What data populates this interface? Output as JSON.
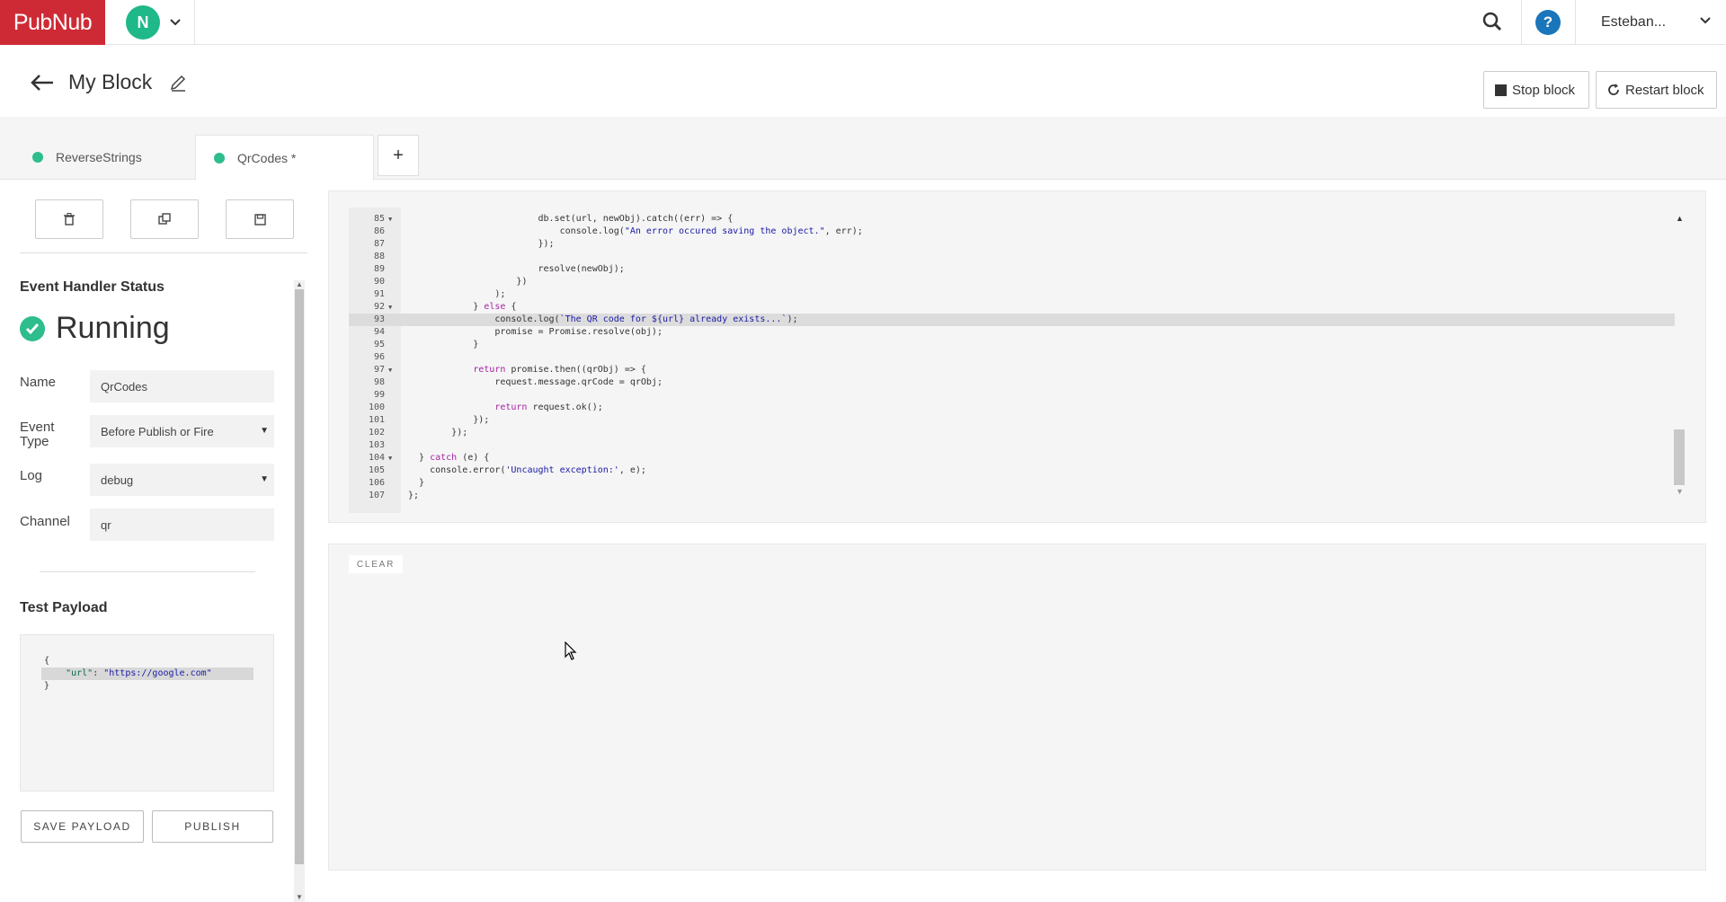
{
  "topbar": {
    "logo": "PubNub",
    "account_initial": "N",
    "user_name": "Esteban...",
    "help_glyph": "?"
  },
  "header": {
    "title": "My Block",
    "stop_label": "Stop block",
    "restart_label": "Restart block"
  },
  "tabs": [
    {
      "label": "ReverseStrings",
      "active": false,
      "status_color": "#2ebd8c"
    },
    {
      "label": "QrCodes *",
      "active": true,
      "status_color": "#2ebd8c"
    }
  ],
  "tab_add_label": "+",
  "left_panel": {
    "status_heading": "Event Handler Status",
    "status_text": "Running",
    "fields": {
      "name_label": "Name",
      "name_value": "QrCodes",
      "event_type_label": "Event Type",
      "event_type_value": "Before Publish or Fire",
      "log_label": "Log",
      "log_value": "debug",
      "channel_label": "Channel",
      "channel_value": "qr"
    },
    "test_payload_heading": "Test Payload",
    "payload": {
      "open": "{",
      "key": "\"url\"",
      "sep": ": ",
      "value": "\"https://google.com\"",
      "close": "}"
    },
    "save_payload_label": "SAVE PAYLOAD",
    "publish_label": "PUBLISH"
  },
  "editor": {
    "lines": [
      {
        "n": "85",
        "fold": true,
        "indent": 24,
        "parts": [
          [
            "",
            "db.set(url, newObj).catch((err) => {"
          ]
        ]
      },
      {
        "n": "86",
        "fold": false,
        "indent": 28,
        "parts": [
          [
            "",
            "console.log("
          ],
          [
            "str",
            "\"An error occured saving the object.\""
          ],
          [
            "",
            ", err);"
          ]
        ]
      },
      {
        "n": "87",
        "fold": false,
        "indent": 24,
        "parts": [
          [
            "",
            "});"
          ]
        ]
      },
      {
        "n": "88",
        "fold": false,
        "indent": 0,
        "parts": []
      },
      {
        "n": "89",
        "fold": false,
        "indent": 24,
        "parts": [
          [
            "",
            "resolve(newObj);"
          ]
        ]
      },
      {
        "n": "90",
        "fold": false,
        "indent": 20,
        "parts": [
          [
            "",
            "})"
          ]
        ]
      },
      {
        "n": "91",
        "fold": false,
        "indent": 16,
        "parts": [
          [
            "",
            ");"
          ]
        ]
      },
      {
        "n": "92",
        "fold": true,
        "indent": 12,
        "parts": [
          [
            "",
            "} "
          ],
          [
            "kw",
            "else"
          ],
          [
            "",
            " {"
          ]
        ]
      },
      {
        "n": "93",
        "fold": false,
        "indent": 16,
        "hl": true,
        "parts": [
          [
            "",
            "console.log("
          ],
          [
            "str",
            "`The QR code for ${url} already exists...`"
          ],
          [
            "",
            ");"
          ]
        ]
      },
      {
        "n": "94",
        "fold": false,
        "indent": 16,
        "parts": [
          [
            "",
            "promise = Promise.resolve(obj);"
          ]
        ]
      },
      {
        "n": "95",
        "fold": false,
        "indent": 12,
        "parts": [
          [
            "",
            "}"
          ]
        ]
      },
      {
        "n": "96",
        "fold": false,
        "indent": 0,
        "parts": []
      },
      {
        "n": "97",
        "fold": true,
        "indent": 12,
        "parts": [
          [
            "kw",
            "return"
          ],
          [
            "",
            " promise.then((qrObj) => {"
          ]
        ]
      },
      {
        "n": "98",
        "fold": false,
        "indent": 16,
        "parts": [
          [
            "",
            "request.message.qrCode = qrObj;"
          ]
        ]
      },
      {
        "n": "99",
        "fold": false,
        "indent": 0,
        "parts": []
      },
      {
        "n": "100",
        "fold": false,
        "indent": 16,
        "parts": [
          [
            "kw",
            "return"
          ],
          [
            "",
            " request.ok();"
          ]
        ]
      },
      {
        "n": "101",
        "fold": false,
        "indent": 12,
        "parts": [
          [
            "",
            "});"
          ]
        ]
      },
      {
        "n": "102",
        "fold": false,
        "indent": 8,
        "parts": [
          [
            "",
            "});"
          ]
        ]
      },
      {
        "n": "103",
        "fold": false,
        "indent": 0,
        "parts": []
      },
      {
        "n": "104",
        "fold": true,
        "indent": 2,
        "parts": [
          [
            "",
            "} "
          ],
          [
            "kw",
            "catch"
          ],
          [
            "",
            " (e) {"
          ]
        ]
      },
      {
        "n": "105",
        "fold": false,
        "indent": 4,
        "parts": [
          [
            "",
            "console.error("
          ],
          [
            "str",
            "'Uncaught exception:'"
          ],
          [
            "",
            ", e);"
          ]
        ]
      },
      {
        "n": "106",
        "fold": false,
        "indent": 2,
        "parts": [
          [
            "",
            "}"
          ]
        ]
      },
      {
        "n": "107",
        "fold": false,
        "indent": 0,
        "parts": [
          [
            "",
            "};"
          ]
        ]
      }
    ]
  },
  "console": {
    "clear_label": "CLEAR"
  },
  "colors": {
    "brand": "#ce2a35",
    "running": "#2ebd8c",
    "help": "#1a75bb"
  }
}
